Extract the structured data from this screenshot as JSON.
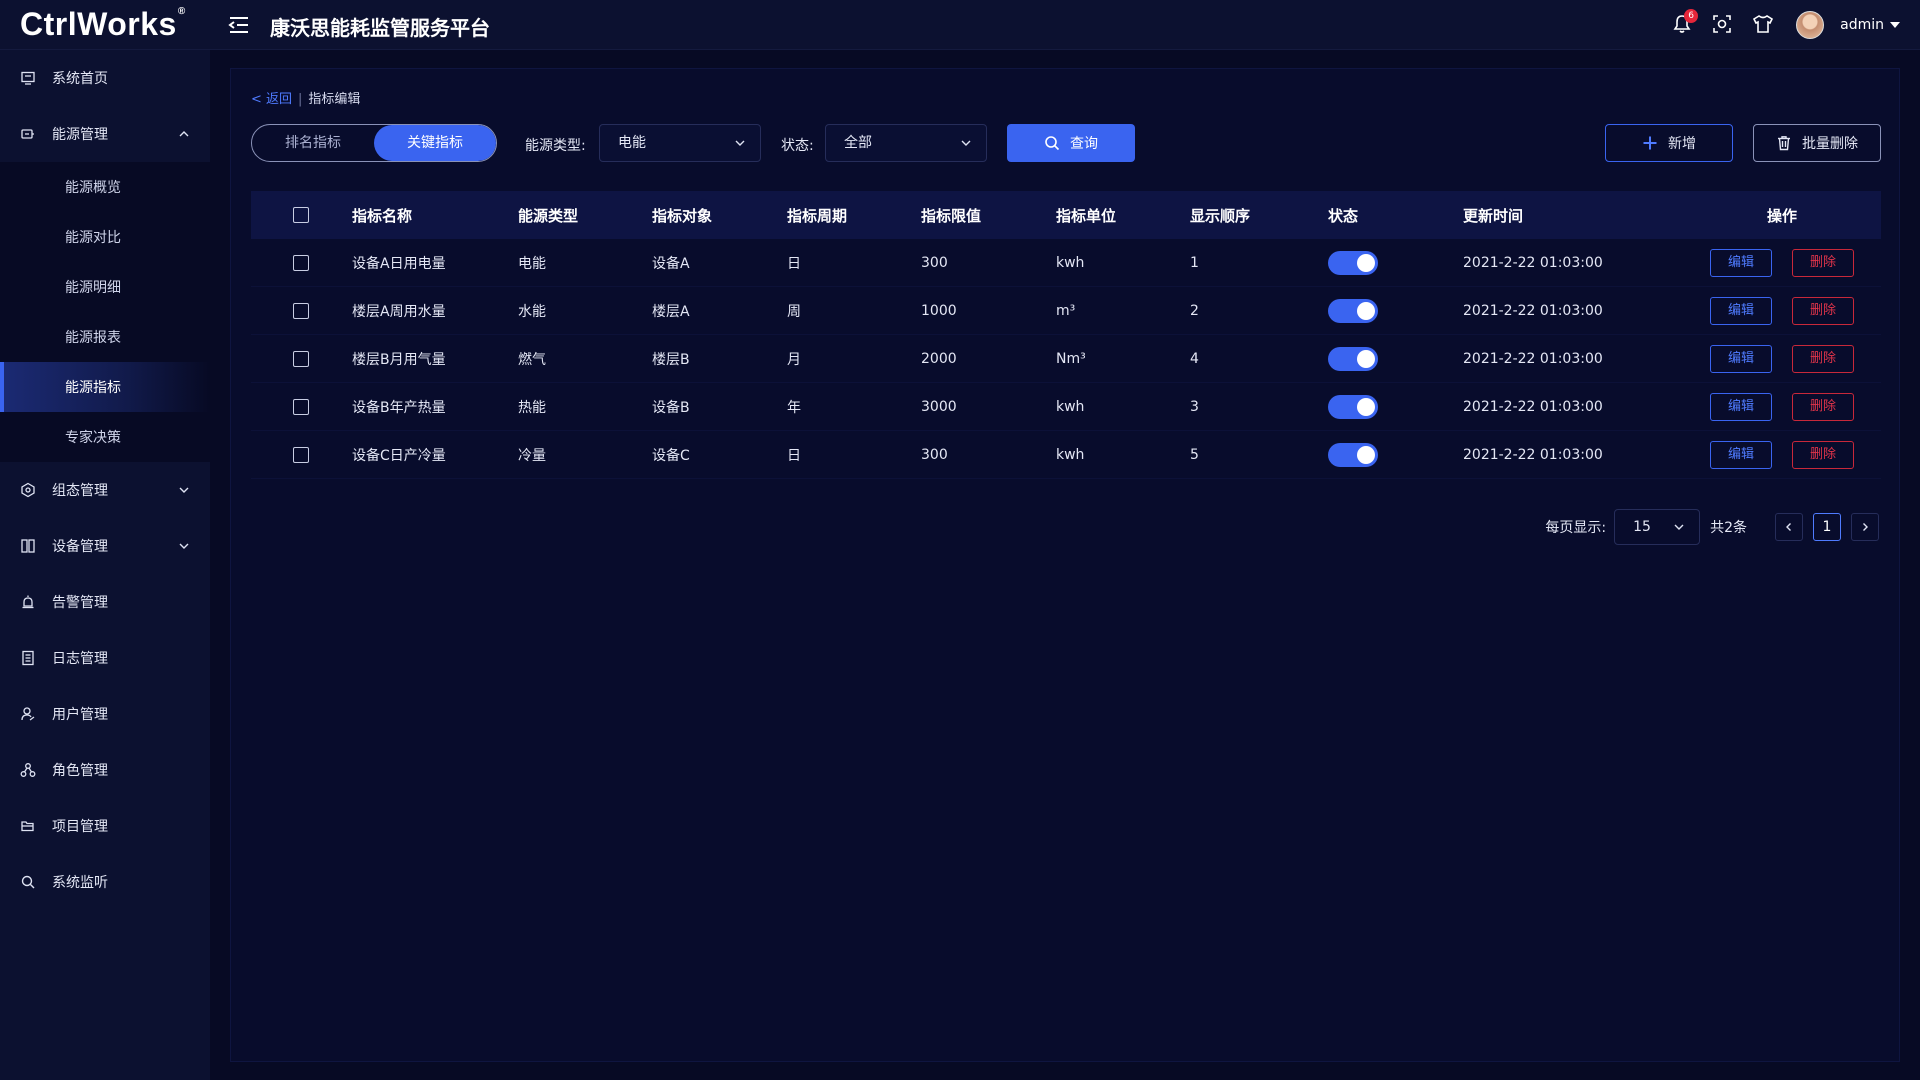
{
  "header": {
    "logo": "CtrlWorks",
    "logo_mark": "®",
    "title": "康沃思能耗监管服务平台",
    "notification_count": "6",
    "user": "admin"
  },
  "sidebar": {
    "items": [
      {
        "label": "系统首页"
      },
      {
        "label": "能源管理"
      },
      {
        "label": "组态管理"
      },
      {
        "label": "设备管理"
      },
      {
        "label": "告警管理"
      },
      {
        "label": "日志管理"
      },
      {
        "label": "用户管理"
      },
      {
        "label": "角色管理"
      },
      {
        "label": "项目管理"
      },
      {
        "label": "系统监听"
      }
    ],
    "energy_sub": [
      {
        "label": "能源概览"
      },
      {
        "label": "能源对比"
      },
      {
        "label": "能源明细"
      },
      {
        "label": "能源报表"
      },
      {
        "label": "能源指标"
      },
      {
        "label": "专家决策"
      }
    ]
  },
  "breadcrumb": {
    "back": "< 返回",
    "current": "指标编辑"
  },
  "toolbar": {
    "tabs": [
      "排名指标",
      "关键指标"
    ],
    "energy_type_label": "能源类型:",
    "energy_type_value": "电能",
    "status_label": "状态:",
    "status_value": "全部",
    "query": "查询",
    "add": "新增",
    "batch_delete": "批量删除"
  },
  "table": {
    "headers": [
      "指标名称",
      "能源类型",
      "指标对象",
      "指标周期",
      "指标限值",
      "指标单位",
      "显示顺序",
      "状态",
      "更新时间",
      "操作"
    ],
    "rows": [
      {
        "name": "设备A日用电量",
        "type": "电能",
        "object": "设备A",
        "cycle": "日",
        "limit": "300",
        "unit": "kwh",
        "order": "1",
        "time": "2021-2-22  01:03:00"
      },
      {
        "name": "楼层A周用水量",
        "type": "水能",
        "object": "楼层A",
        "cycle": "周",
        "limit": "1000",
        "unit": "m³",
        "order": "2",
        "time": "2021-2-22  01:03:00"
      },
      {
        "name": "楼层B月用气量",
        "type": "燃气",
        "object": "楼层B",
        "cycle": "月",
        "limit": "2000",
        "unit": "Nm³",
        "order": "4",
        "time": "2021-2-22  01:03:00"
      },
      {
        "name": "设备B年产热量",
        "type": "热能",
        "object": "设备B",
        "cycle": "年",
        "limit": "3000",
        "unit": "kwh",
        "order": "3",
        "time": "2021-2-22  01:03:00"
      },
      {
        "name": "设备C日产冷量",
        "type": "冷量",
        "object": "设备C",
        "cycle": "日",
        "limit": "300",
        "unit": "kwh",
        "order": "5",
        "time": "2021-2-22  01:03:00"
      }
    ],
    "edit_label": "编辑",
    "delete_label": "删除"
  },
  "pagination": {
    "per_page_label": "每页显示:",
    "per_page": "15",
    "total": "共2条",
    "current_page": "1"
  },
  "colors": {
    "accent": "#3a64f0",
    "danger": "#e0344a",
    "bg": "#070a24"
  }
}
